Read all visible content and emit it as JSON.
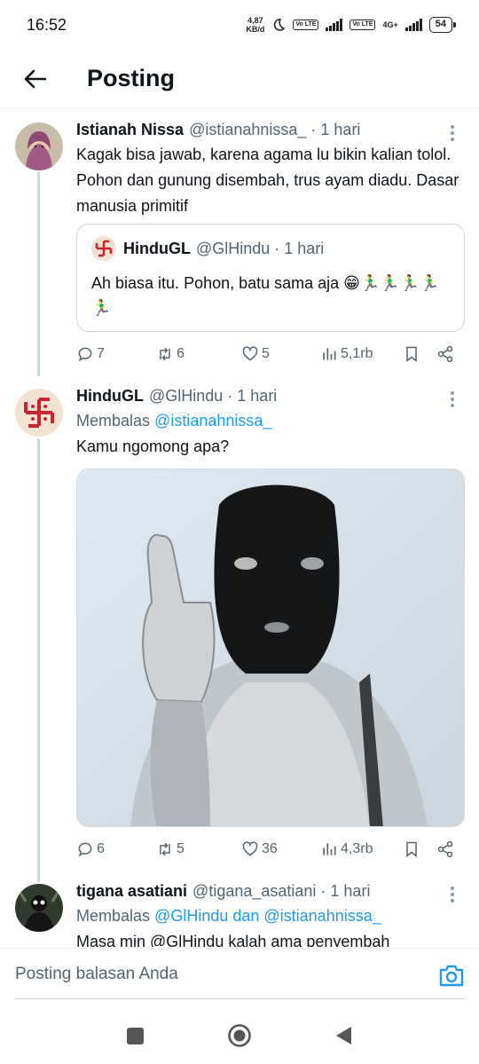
{
  "status_bar": {
    "time": "16:52",
    "net_speed": "4,87",
    "net_unit": "KB/d",
    "volte1": "Vo LTE",
    "volte2": "Vo LTE",
    "network": "4G+",
    "battery": "54"
  },
  "header": {
    "title": "Posting",
    "back_icon": "arrow-left-icon"
  },
  "tweets": [
    {
      "name": "Istianah Nissa",
      "handle": "@istianahnissa_ · 1 hari",
      "text": "Kagak bisa jawab, karena  agama lu bikin kalian tolol. Pohon dan gunung disembah, trus ayam diadu. Dasar manusia primitif",
      "quote": {
        "name": "HinduGL",
        "handle": "@GlHindu · 1 hari",
        "text": "Ah biasa itu. Pohon, batu sama aja 😁🏃‍♂️🏃‍♂️🏃‍♂️🏃‍♂️🏃‍♂️"
      },
      "stats": {
        "replies": "7",
        "retweets": "6",
        "likes": "5",
        "views": "5,1rb"
      }
    },
    {
      "name": "HinduGL",
      "handle": "@GlHindu · 1 hari",
      "reply_prefix": "Membalas",
      "reply_link": "@istianahnissa_",
      "text": "Kamu ngomong apa?",
      "stats": {
        "replies": "6",
        "retweets": "5",
        "likes": "36",
        "views": "4,3rb"
      }
    },
    {
      "name": "tigana asatiani",
      "handle": "@tigana_asatiani · 1 hari",
      "reply_prefix": "Membalas",
      "reply_link": "@GlHindu dan @istianahnissa_",
      "text": "Masa min @GlHindu  kalah ama  penyembah"
    }
  ],
  "compose": {
    "placeholder": "Posting balasan Anda",
    "camera_icon": "camera-icon"
  },
  "navbar": {
    "recents_icon": "square-icon",
    "home_icon": "circle-home-icon",
    "back_icon": "triangle-back-icon"
  },
  "colors": {
    "accent": "#1d9bf0",
    "muted": "#536471",
    "swastika_bg": "#f4e3d2",
    "swastika": "#c9262f"
  }
}
